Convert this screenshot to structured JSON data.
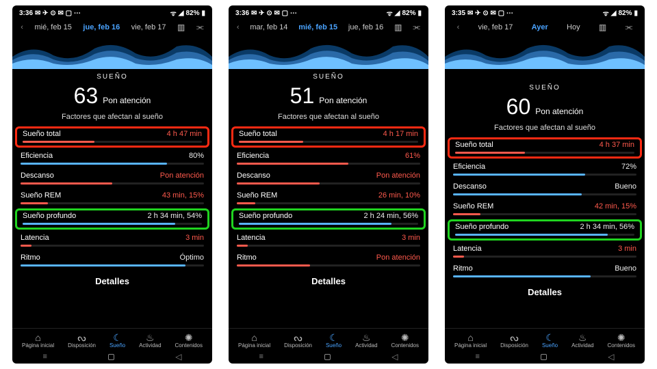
{
  "phones": [
    {
      "statusbar": {
        "time": "3:36",
        "battery": "82%"
      },
      "dates": {
        "l": "mié, feb 15",
        "c": "jue, feb 16",
        "r": "vie, feb 17"
      },
      "section": "SUEÑO",
      "score": "63",
      "score_label": "Pon atención",
      "factors_title": "Factores que afectan al sueño",
      "metrics": {
        "total": {
          "label": "Sueño total",
          "value": "4 h 47 min",
          "color": "red",
          "fill": 40,
          "barcolor": "red",
          "hl": "red"
        },
        "eff": {
          "label": "Eficiencia",
          "value": "80%",
          "color": "white",
          "fill": 80,
          "barcolor": "blue"
        },
        "rest": {
          "label": "Descanso",
          "value": "Pon atención",
          "color": "red",
          "fill": 50,
          "barcolor": "red"
        },
        "rem": {
          "label": "Sueño REM",
          "value": "43 min, 15%",
          "color": "red",
          "fill": 15,
          "barcolor": "red"
        },
        "deep": {
          "label": "Sueño profundo",
          "value": "2 h 34 min, 54%",
          "color": "white",
          "fill": 85,
          "barcolor": "blue",
          "hl": "green"
        },
        "lat": {
          "label": "Latencia",
          "value": "3 min",
          "color": "red",
          "fill": 6,
          "barcolor": "red"
        },
        "rit": {
          "label": "Ritmo",
          "value": "Óptimo",
          "color": "white",
          "fill": 90,
          "barcolor": "blue"
        }
      },
      "details": "Detalles",
      "tabs": {
        "home": "Página inicial",
        "disp": "Disposición",
        "sleep": "Sueño",
        "act": "Actividad",
        "cont": "Contenidos"
      }
    },
    {
      "statusbar": {
        "time": "3:36",
        "battery": "82%"
      },
      "dates": {
        "l": "mar, feb 14",
        "c": "mié, feb 15",
        "r": "jue, feb 16"
      },
      "section": "SUEÑO",
      "score": "51",
      "score_label": "Pon atención",
      "factors_title": "Factores que afectan al sueño",
      "metrics": {
        "total": {
          "label": "Sueño total",
          "value": "4 h 17 min",
          "color": "red",
          "fill": 36,
          "barcolor": "red",
          "hl": "red"
        },
        "eff": {
          "label": "Eficiencia",
          "value": "61%",
          "color": "red",
          "fill": 61,
          "barcolor": "red"
        },
        "rest": {
          "label": "Descanso",
          "value": "Pon atención",
          "color": "red",
          "fill": 45,
          "barcolor": "red"
        },
        "rem": {
          "label": "Sueño REM",
          "value": "26 min, 10%",
          "color": "red",
          "fill": 10,
          "barcolor": "red"
        },
        "deep": {
          "label": "Sueño profundo",
          "value": "2 h 24 min, 56%",
          "color": "white",
          "fill": 85,
          "barcolor": "blue",
          "hl": "green"
        },
        "lat": {
          "label": "Latencia",
          "value": "3 min",
          "color": "red",
          "fill": 6,
          "barcolor": "red"
        },
        "rit": {
          "label": "Ritmo",
          "value": "Pon atención",
          "color": "red",
          "fill": 40,
          "barcolor": "red"
        }
      },
      "details": "Detalles",
      "tabs": {
        "home": "Página inicial",
        "disp": "Disposición",
        "sleep": "Sueño",
        "act": "Actividad",
        "cont": "Contenidos"
      }
    },
    {
      "statusbar": {
        "time": "3:35",
        "battery": "82%"
      },
      "dates": {
        "l": "vie, feb 17",
        "c": "Ayer",
        "r": "Hoy"
      },
      "section": "SUEÑO",
      "score": "60",
      "score_label": "Pon atención",
      "factors_title": "Factores que afectan al sueño",
      "metrics": {
        "total": {
          "label": "Sueño total",
          "value": "4 h 37 min",
          "color": "red",
          "fill": 39,
          "barcolor": "red",
          "hl": "red"
        },
        "eff": {
          "label": "Eficiencia",
          "value": "72%",
          "color": "white",
          "fill": 72,
          "barcolor": "blue"
        },
        "rest": {
          "label": "Descanso",
          "value": "Bueno",
          "color": "white",
          "fill": 70,
          "barcolor": "blue"
        },
        "rem": {
          "label": "Sueño REM",
          "value": "42 min, 15%",
          "color": "red",
          "fill": 15,
          "barcolor": "red"
        },
        "deep": {
          "label": "Sueño profundo",
          "value": "2 h 34 min, 56%",
          "color": "white",
          "fill": 85,
          "barcolor": "blue",
          "hl": "green"
        },
        "lat": {
          "label": "Latencia",
          "value": "3 min",
          "color": "red",
          "fill": 6,
          "barcolor": "red"
        },
        "rit": {
          "label": "Ritmo",
          "value": "Bueno",
          "color": "white",
          "fill": 75,
          "barcolor": "blue"
        }
      },
      "details": "Detalles",
      "tabs": {
        "home": "Página inicial",
        "disp": "Disposición",
        "sleep": "Sueño",
        "act": "Actividad",
        "cont": "Contenidos"
      }
    }
  ],
  "chart_data": {
    "type": "area",
    "note": "mini sleep-stage stacked area thumbnails (decorative)",
    "series": [
      {
        "name": "deep",
        "color": "#0a3a66"
      },
      {
        "name": "light",
        "color": "#2a6aa8"
      },
      {
        "name": "rem",
        "color": "#6ec0ff"
      }
    ]
  }
}
